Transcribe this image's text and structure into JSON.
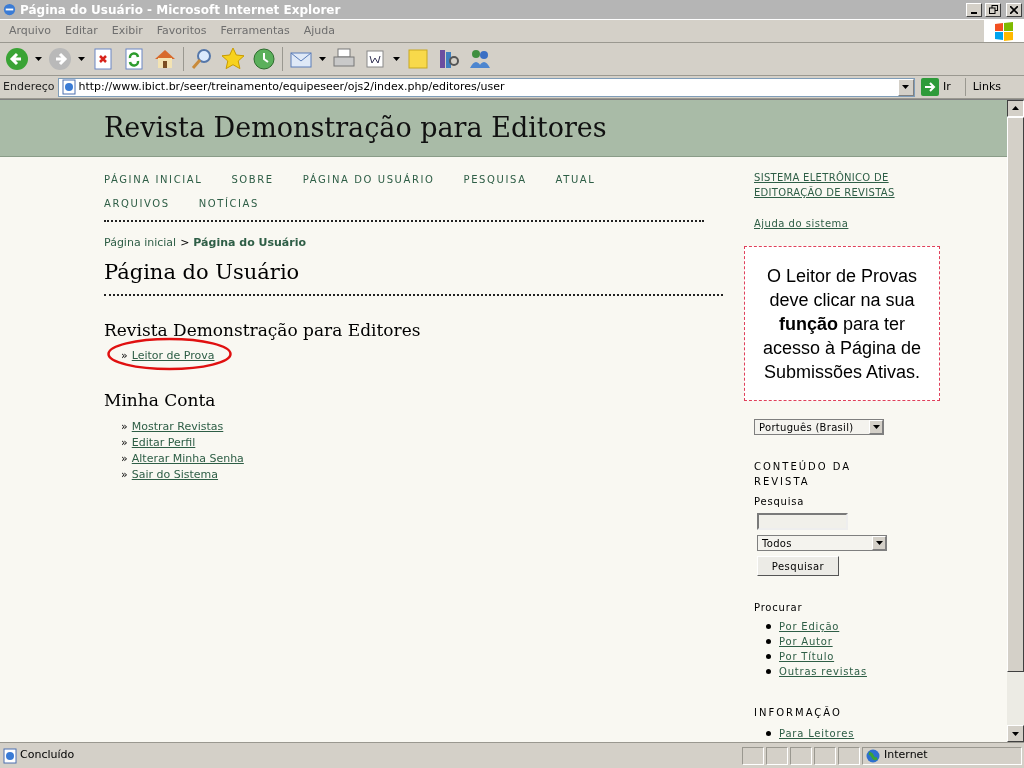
{
  "window": {
    "title": "Página do Usuário - Microsoft Internet Explorer"
  },
  "menu": [
    "Arquivo",
    "Editar",
    "Exibir",
    "Favoritos",
    "Ferramentas",
    "Ajuda"
  ],
  "address_bar": {
    "label": "Endereço",
    "url": "http://www.ibict.br/seer/treinamento/equipeseer/ojs2/index.php/editores/user",
    "go": "Ir",
    "links": "Links"
  },
  "page": {
    "journal_title": "Revista Demonstração para Editores",
    "nav": [
      "PÁGINA INICIAL",
      "SOBRE",
      "PÁGINA DO USUÁRIO",
      "PESQUISA",
      "ATUAL",
      "ARQUIVOS",
      "NOTÍCIAS"
    ],
    "breadcrumb": {
      "home": "Página inicial",
      "separator": ">",
      "current": "Página do Usuário"
    },
    "heading": "Página do Usuário",
    "journal_section": {
      "title": "Revista Demonstração para Editores",
      "bullet": "»",
      "roles": [
        "Leitor de Prova"
      ]
    },
    "account": {
      "title": "Minha Conta",
      "bullet": "»",
      "links": [
        "Mostrar Revistas",
        "Editar Perfil",
        "Alterar Minha Senha",
        "Sair do Sistema"
      ]
    },
    "sidebar": {
      "system_link": "SISTEMA ELETRÔNICO DE EDITORAÇÃO DE REVISTAS",
      "help": "Ajuda do sistema",
      "language": "Português (Brasil)",
      "content_title": "CONTEÚDO DA REVISTA",
      "search_label": "Pesquisa",
      "search_scope": "Todos",
      "search_button": "Pesquisar",
      "browse_label": "Procurar",
      "browse": [
        "Por Edição",
        "Por Autor",
        "Por Título",
        "Outras revistas"
      ],
      "info_title": "INFORMAÇÃO",
      "info": [
        "Para Leitores"
      ]
    }
  },
  "callout": "O Leitor de Provas deve clicar na sua **função** para ter acesso à Página de Submissões Ativas.",
  "status_bar": {
    "text": "Concluído",
    "zone": "Internet"
  }
}
